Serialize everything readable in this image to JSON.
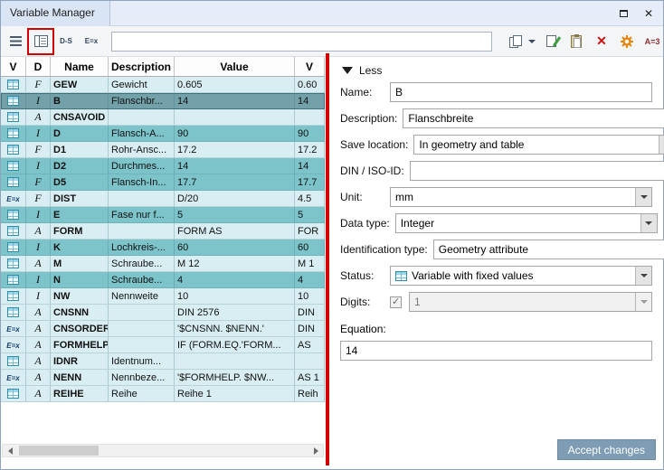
{
  "window": {
    "title": "Variable Manager"
  },
  "toolbar": {
    "filter_value": "",
    "ds_label": "D-S",
    "ex_label": "E=x",
    "a3_label": "A=3"
  },
  "table": {
    "headers": [
      "V",
      "D",
      "Name",
      "Description",
      "Value",
      "V"
    ],
    "rows": [
      {
        "icon": "table",
        "dtype": "F",
        "name": "GEW",
        "description": "Gewicht",
        "value": "0.605",
        "value2": "0.60",
        "shade": "light"
      },
      {
        "icon": "table",
        "dtype": "I",
        "name": "B",
        "description": "Flanschbr...",
        "value": "14",
        "value2": "14",
        "shade": "selected"
      },
      {
        "icon": "table",
        "dtype": "A",
        "name": "CNSAVOID",
        "description": "",
        "value": "",
        "value2": "",
        "shade": "light"
      },
      {
        "icon": "table",
        "dtype": "I",
        "name": "D",
        "description": "Flansch-A...",
        "value": "90",
        "value2": "90",
        "shade": "teal"
      },
      {
        "icon": "table",
        "dtype": "F",
        "name": "D1",
        "description": "Rohr-Ansc...",
        "value": "17.2",
        "value2": "17.2",
        "shade": "light"
      },
      {
        "icon": "table",
        "dtype": "I",
        "name": "D2",
        "description": "Durchmes...",
        "value": "14",
        "value2": "14",
        "shade": "teal"
      },
      {
        "icon": "table",
        "dtype": "F",
        "name": "D5",
        "description": "Flansch-In...",
        "value": "17.7",
        "value2": "17.7",
        "shade": "teal"
      },
      {
        "icon": "fx",
        "dtype": "F",
        "name": "DIST",
        "description": "",
        "value": "D/20",
        "value2": "4.5",
        "shade": "light"
      },
      {
        "icon": "table",
        "dtype": "I",
        "name": "E",
        "description": "Fase nur f...",
        "value": "5",
        "value2": "5",
        "shade": "teal"
      },
      {
        "icon": "table",
        "dtype": "A",
        "name": "FORM",
        "description": "",
        "value": "FORM AS",
        "value2": "FOR",
        "shade": "light"
      },
      {
        "icon": "table",
        "dtype": "I",
        "name": "K",
        "description": "Lochkreis-...",
        "value": "60",
        "value2": "60",
        "shade": "teal"
      },
      {
        "icon": "table",
        "dtype": "A",
        "name": "M",
        "description": "Schraube...",
        "value": "M 12",
        "value2": "M 1",
        "shade": "light"
      },
      {
        "icon": "table",
        "dtype": "I",
        "name": "N",
        "description": "Schraube...",
        "value": "4",
        "value2": "4",
        "shade": "teal"
      },
      {
        "icon": "table",
        "dtype": "I",
        "name": "NW",
        "description": "Nennweite",
        "value": "10",
        "value2": "10",
        "shade": "light"
      },
      {
        "icon": "table",
        "dtype": "A",
        "name": "CNSNN",
        "description": "",
        "value": "DIN 2576",
        "value2": "DIN",
        "shade": "light"
      },
      {
        "icon": "fx",
        "dtype": "A",
        "name": "CNSORDER",
        "description": "",
        "value": "'$CNSNN. $NENN.'",
        "value2": "DIN",
        "shade": "light"
      },
      {
        "icon": "fx",
        "dtype": "A",
        "name": "FORMHELP",
        "description": "",
        "value": "IF (FORM.EQ.'FORM...",
        "value2": "AS",
        "shade": "light"
      },
      {
        "icon": "table",
        "dtype": "A",
        "name": "IDNR",
        "description": "Identnum...",
        "value": "",
        "value2": "",
        "shade": "light"
      },
      {
        "icon": "fx",
        "dtype": "A",
        "name": "NENN",
        "description": "Nennbeze...",
        "value": "'$FORMHELP. $NW...",
        "value2": "AS 1",
        "shade": "light"
      },
      {
        "icon": "table",
        "dtype": "A",
        "name": "REIHE",
        "description": "Reihe",
        "value": "Reihe 1",
        "value2": "Reih",
        "shade": "light"
      }
    ]
  },
  "form": {
    "less_label": "Less",
    "fields": [
      {
        "key": "name",
        "label": "Name:",
        "type": "text",
        "value": "B"
      },
      {
        "key": "description",
        "label": "Description:",
        "type": "text",
        "value": "Flanschbreite"
      },
      {
        "key": "save_location",
        "label": "Save location:",
        "type": "select",
        "value": "In geometry and table"
      },
      {
        "key": "din_iso_id",
        "label": "DIN / ISO-ID:",
        "type": "text",
        "value": ""
      },
      {
        "key": "unit",
        "label": "Unit:",
        "type": "select",
        "value": "mm"
      },
      {
        "key": "data_type",
        "label": "Data type:",
        "type": "select",
        "value": "Integer"
      },
      {
        "key": "identification_type",
        "label": "Identification type:",
        "type": "select",
        "value": "Geometry attribute"
      },
      {
        "key": "status",
        "label": "Status:",
        "type": "select-icon",
        "value": "Variable with fixed values",
        "gap": true
      },
      {
        "key": "digits",
        "label": "Digits:",
        "type": "digits",
        "value": "1",
        "checked": true,
        "disabled": true,
        "gap": true
      },
      {
        "key": "equation",
        "label": "Equation:",
        "type": "equation",
        "value": "14"
      }
    ],
    "accept_label": "Accept changes"
  }
}
